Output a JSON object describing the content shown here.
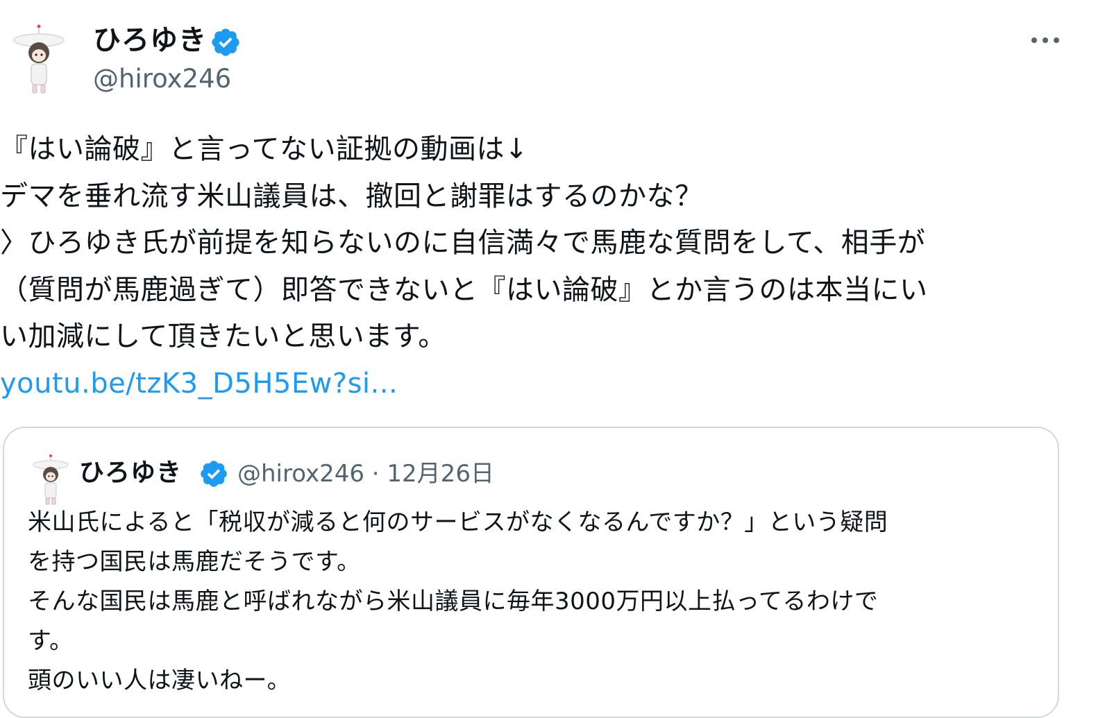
{
  "tweet": {
    "author": {
      "display_name": "ひろゆき",
      "handle": "@hirox246",
      "verified": true
    },
    "text_lines": [
      "『はい論破』と言ってない証拠の動画は↓",
      "デマを垂れ流す米山議員は、撤回と謝罪はするのかな？",
      "〉ひろゆき氏が前提を知らないのに自信満々で馬鹿な質問をして、相手が",
      "（質問が馬鹿過ぎて）即答できないと『はい論破』とか言うのは本当にい",
      "い加減にして頂きたいと思います。"
    ],
    "link": "youtu.be/tzK3_D5H5Ew?si..."
  },
  "quote": {
    "author": {
      "display_name": "ひろゆき",
      "verified": true
    },
    "meta": "@hirox246 · 12月26日",
    "text_lines": [
      "米山氏によると「税収が減ると何のサービスがなくなるんですか？」という疑問",
      "を持つ国民は馬鹿だそうです。",
      "そんな国民は馬鹿と呼ばれながら米山議員に毎年3000万円以上払ってるわけで",
      "す。",
      "頭のいい人は凄いねー。"
    ]
  },
  "colors": {
    "text": "#0f1419",
    "secondary": "#536471",
    "link": "#1d9bf0",
    "verified": "#1d9bf0",
    "border": "#cfd9de"
  },
  "icons": {
    "verified": "verified-badge-icon",
    "more": "more-horizontal-icon"
  }
}
